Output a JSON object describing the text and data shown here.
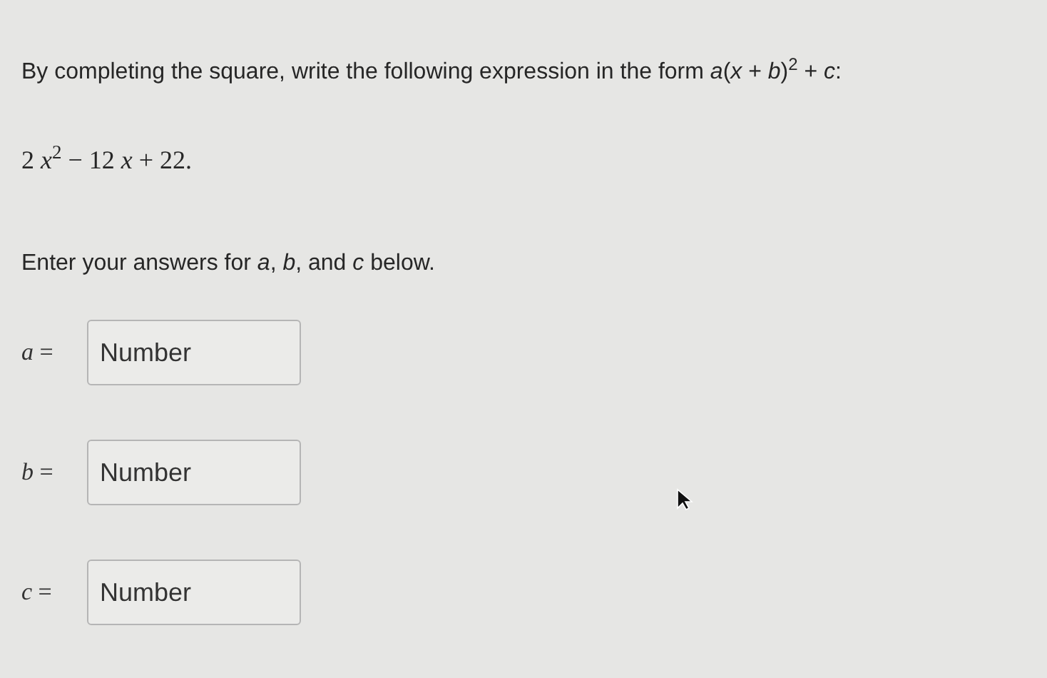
{
  "question": "By completing the square, write the following expression in the form *a*(*x* + *b*)$^{2}$ + *c*:",
  "expression": "2 *x*$^{2}$ − 12 *x* + 22.",
  "instruction": "Enter your answers for *a*, *b*, and *c* below.",
  "fields": [
    {
      "label": "*a* =",
      "placeholder": "Number"
    },
    {
      "label": "*b* =",
      "placeholder": "Number"
    },
    {
      "label": "*c* =",
      "placeholder": "Number"
    }
  ]
}
